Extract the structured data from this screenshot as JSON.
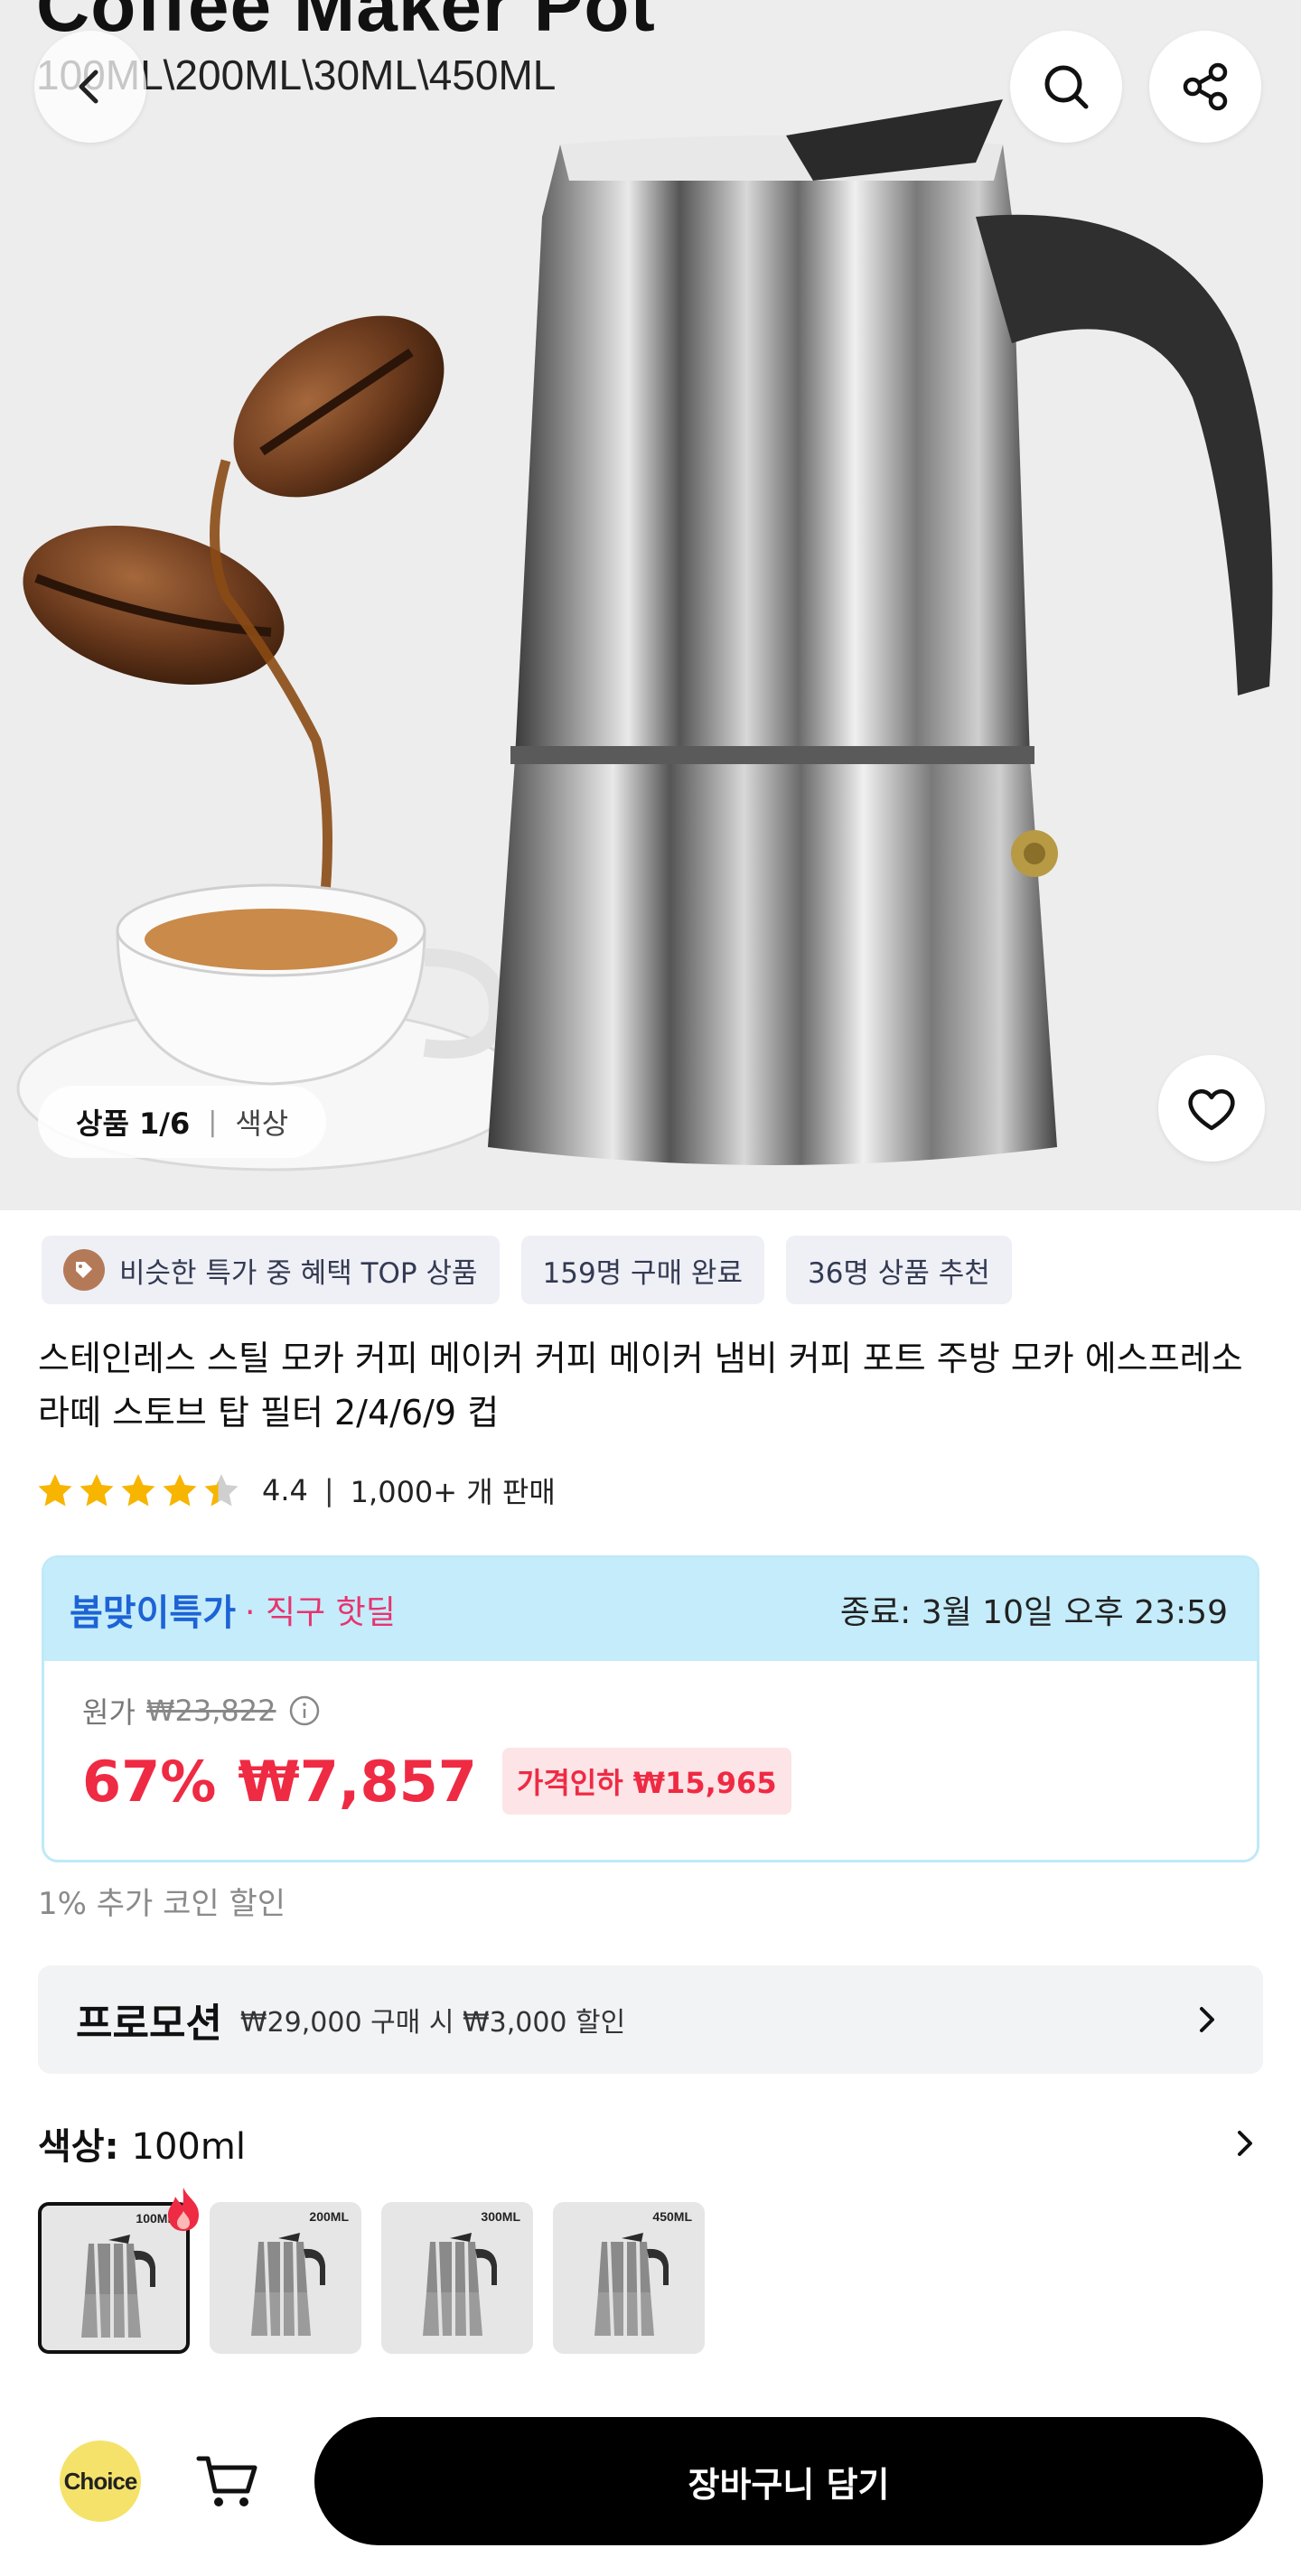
{
  "hero": {
    "title": "Coffee Maker Pot",
    "sizes": "100ML\\200ML\\30ML\\450ML",
    "counter_current": "상품 1/6",
    "counter_sep": "|",
    "counter_category": "색상"
  },
  "badges": [
    {
      "label": "비슷한 특가 중 혜택 TOP 상품"
    },
    {
      "label": "159명 구매 완료"
    },
    {
      "label": "36명 상품 추천"
    }
  ],
  "product": {
    "title": "스테인레스 스틸 모카 커피 메이커 커피 메이커 냄비 커피 포트 주방 모카 에스프레소 라떼 스토브 탑 필터 2/4/6/9 컵",
    "rating": 4.4,
    "rating_text": "4.4",
    "rating_sep": "|",
    "sold": "1,000+ 개 판매"
  },
  "deal": {
    "brand": "봄맞이특가",
    "sub": "· 직구 핫딜",
    "ends": "종료: 3월 10일 오후 23:59",
    "original_label": "원가",
    "original_price": "₩23,822",
    "discount": "67%",
    "price": "₩7,857",
    "price_drop": "가격인하 ₩15,965"
  },
  "coin_note": "1% 추가 코인 할인",
  "promotion": {
    "label": "프로모션",
    "text": "₩29,000 구매 시 ₩3,000 할인"
  },
  "color": {
    "label_prefix": "색상: ",
    "selected": "100ml",
    "variants": [
      {
        "label": "100ML",
        "selected": true
      },
      {
        "label": "200ML",
        "selected": false
      },
      {
        "label": "300ML",
        "selected": false
      },
      {
        "label": "450ML",
        "selected": false
      }
    ]
  },
  "bottom": {
    "choice_logo": "Choice",
    "cart_button": "장바구니 담기"
  },
  "colors": {
    "price_red": "#ef2a43",
    "deal_blue": "#1d63d6",
    "deal_pink": "#e8336f",
    "deal_bg": "#c4ecfa",
    "star": "#f7b500",
    "choice_yellow": "#f5e26a"
  }
}
